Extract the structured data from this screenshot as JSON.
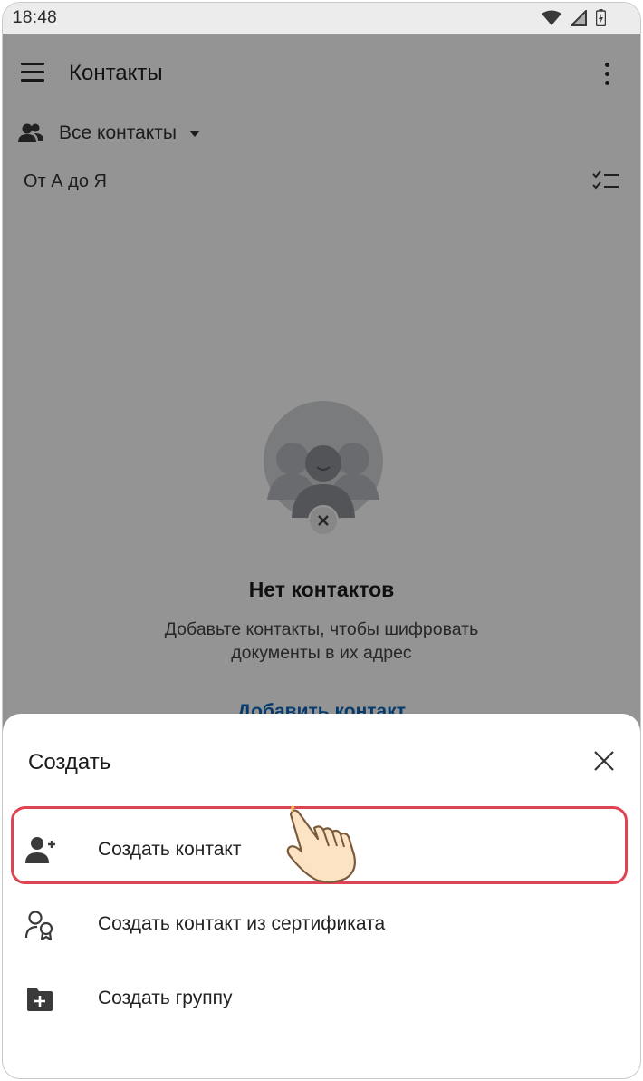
{
  "status_bar": {
    "time": "18:48",
    "icons": [
      "wifi-icon",
      "signal-icon",
      "battery-icon"
    ]
  },
  "app_bar": {
    "title": "Контакты",
    "menu_icon": "hamburger-menu-icon",
    "more_icon": "more-vert-icon"
  },
  "filter": {
    "icon": "contacts-group-icon",
    "label": "Все контакты"
  },
  "sort": {
    "label": "От А до Я",
    "select_icon": "checklist-icon"
  },
  "empty_state": {
    "title": "Нет контактов",
    "description_lines": [
      "Добавьте контакты, чтобы шифровать",
      "документы в их адрес"
    ],
    "action_label": "Добавить контакт"
  },
  "sheet": {
    "title": "Создать",
    "items": [
      {
        "label": "Создать контакт",
        "icon": "person-add-icon",
        "highlighted": true
      },
      {
        "label": "Создать контакт из сертификата",
        "icon": "certificate-person-icon",
        "highlighted": false
      },
      {
        "label": "Создать группу",
        "icon": "folder-plus-icon",
        "highlighted": false
      }
    ]
  },
  "colors": {
    "accent": "#0d66b8",
    "highlight": "#de4452",
    "scrim": "#000000"
  }
}
